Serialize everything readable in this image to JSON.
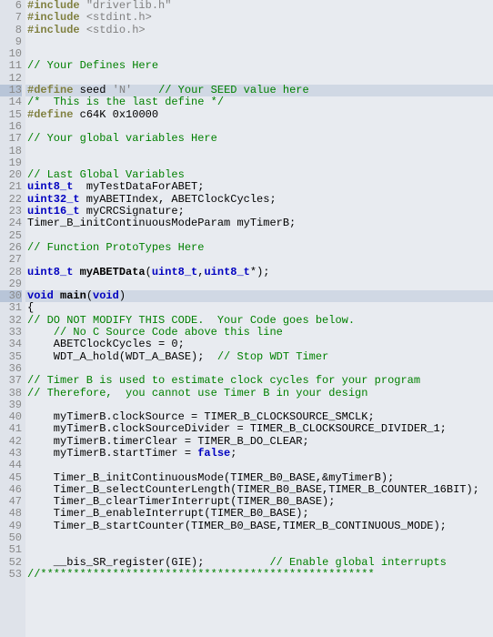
{
  "lines": [
    {
      "num": "6",
      "tokens": [
        [
          "k-pre",
          "#include"
        ],
        [
          "",
          " "
        ],
        [
          "k-str",
          "\"driverlib.h\""
        ]
      ]
    },
    {
      "num": "7",
      "tokens": [
        [
          "k-pre",
          "#include"
        ],
        [
          "",
          " "
        ],
        [
          "k-inc",
          "<stdint.h>"
        ]
      ]
    },
    {
      "num": "8",
      "tokens": [
        [
          "k-pre",
          "#include"
        ],
        [
          "",
          " "
        ],
        [
          "k-inc",
          "<stdio.h>"
        ]
      ]
    },
    {
      "num": "9",
      "tokens": [
        [
          "",
          ""
        ]
      ]
    },
    {
      "num": "10",
      "tokens": [
        [
          "",
          ""
        ]
      ]
    },
    {
      "num": "11",
      "tokens": [
        [
          "k-cmt",
          "// Your Defines Here"
        ]
      ]
    },
    {
      "num": "12",
      "tokens": [
        [
          "",
          ""
        ]
      ]
    },
    {
      "num": "13",
      "highlighted": true,
      "tokens": [
        [
          "k-pre",
          "#define"
        ],
        [
          "",
          " seed "
        ],
        [
          "k-str",
          "'N'"
        ],
        [
          "",
          "    "
        ],
        [
          "k-cmt",
          "// Your SEED value here"
        ]
      ]
    },
    {
      "num": "14",
      "tokens": [
        [
          "k-cmt",
          "/*  This is the last define */"
        ]
      ]
    },
    {
      "num": "15",
      "tokens": [
        [
          "k-pre",
          "#define"
        ],
        [
          "",
          " c64K "
        ],
        [
          "k-num",
          "0x10000"
        ]
      ]
    },
    {
      "num": "16",
      "tokens": [
        [
          "",
          ""
        ]
      ]
    },
    {
      "num": "17",
      "tokens": [
        [
          "k-cmt",
          "// Your global variables Here"
        ]
      ]
    },
    {
      "num": "18",
      "tokens": [
        [
          "",
          ""
        ]
      ]
    },
    {
      "num": "19",
      "tokens": [
        [
          "",
          ""
        ]
      ]
    },
    {
      "num": "20",
      "tokens": [
        [
          "k-cmt",
          "// Last Global Variables"
        ]
      ]
    },
    {
      "num": "21",
      "tokens": [
        [
          "k-type",
          "uint8_t"
        ],
        [
          "",
          "  myTestDataForABET;"
        ]
      ]
    },
    {
      "num": "22",
      "tokens": [
        [
          "k-type",
          "uint32_t"
        ],
        [
          "",
          " myABETIndex, ABETClockCycles;"
        ]
      ]
    },
    {
      "num": "23",
      "tokens": [
        [
          "k-type",
          "uint16_t"
        ],
        [
          "",
          " myCRCSignature;"
        ]
      ]
    },
    {
      "num": "24",
      "tokens": [
        [
          "",
          "Timer_B_initContinuousModeParam myTimerB;"
        ]
      ]
    },
    {
      "num": "25",
      "tokens": [
        [
          "",
          ""
        ]
      ]
    },
    {
      "num": "26",
      "tokens": [
        [
          "k-cmt",
          "// Function ProtoTypes Here"
        ]
      ]
    },
    {
      "num": "27",
      "tokens": [
        [
          "",
          ""
        ]
      ]
    },
    {
      "num": "28",
      "tokens": [
        [
          "k-type",
          "uint8_t"
        ],
        [
          "",
          " "
        ],
        [
          "k-func",
          "myABETData"
        ],
        [
          "",
          "("
        ],
        [
          "k-type",
          "uint8_t"
        ],
        [
          "",
          ","
        ],
        [
          "k-type",
          "uint8_t"
        ],
        [
          "",
          "*);"
        ]
      ]
    },
    {
      "num": "29",
      "tokens": [
        [
          "",
          ""
        ]
      ]
    },
    {
      "num": "30",
      "highlighted": true,
      "tokens": [
        [
          "k-kw",
          "void"
        ],
        [
          "",
          " "
        ],
        [
          "k-func",
          "main"
        ],
        [
          "",
          "("
        ],
        [
          "k-kw",
          "void"
        ],
        [
          "",
          ")"
        ]
      ]
    },
    {
      "num": "31",
      "tokens": [
        [
          "",
          "{"
        ]
      ]
    },
    {
      "num": "32",
      "tokens": [
        [
          "k-cmt",
          "// DO NOT MODIFY THIS CODE.  Your Code goes below."
        ]
      ]
    },
    {
      "num": "33",
      "tokens": [
        [
          "",
          "    "
        ],
        [
          "k-cmt",
          "// No C Source Code above this line"
        ]
      ]
    },
    {
      "num": "34",
      "tokens": [
        [
          "",
          "    ABETClockCycles = 0;"
        ]
      ]
    },
    {
      "num": "35",
      "tokens": [
        [
          "",
          "    WDT_A_hold(WDT_A_BASE);  "
        ],
        [
          "k-cmt",
          "// Stop WDT Timer"
        ]
      ]
    },
    {
      "num": "36",
      "tokens": [
        [
          "",
          ""
        ]
      ]
    },
    {
      "num": "37",
      "tokens": [
        [
          "k-cmt",
          "// Timer B is used to estimate clock cycles for your program"
        ]
      ]
    },
    {
      "num": "38",
      "tokens": [
        [
          "k-cmt",
          "// Therefore,  you cannot use Timer B in your design"
        ]
      ]
    },
    {
      "num": "39",
      "tokens": [
        [
          "",
          ""
        ]
      ]
    },
    {
      "num": "40",
      "tokens": [
        [
          "",
          "    myTimerB.clockSource = TIMER_B_CLOCKSOURCE_SMCLK;"
        ]
      ]
    },
    {
      "num": "41",
      "tokens": [
        [
          "",
          "    myTimerB.clockSourceDivider = TIMER_B_CLOCKSOURCE_DIVIDER_1;"
        ]
      ]
    },
    {
      "num": "42",
      "tokens": [
        [
          "",
          "    myTimerB.timerClear = TIMER_B_DO_CLEAR;"
        ]
      ]
    },
    {
      "num": "43",
      "tokens": [
        [
          "",
          "    myTimerB.startTimer = "
        ],
        [
          "k-kw",
          "false"
        ],
        [
          "",
          ";"
        ]
      ]
    },
    {
      "num": "44",
      "tokens": [
        [
          "",
          ""
        ]
      ]
    },
    {
      "num": "45",
      "tokens": [
        [
          "",
          "    Timer_B_initContinuousMode(TIMER_B0_BASE,&myTimerB);"
        ]
      ]
    },
    {
      "num": "46",
      "tokens": [
        [
          "",
          "    Timer_B_selectCounterLength(TIMER_B0_BASE,TIMER_B_COUNTER_16BIT);"
        ]
      ]
    },
    {
      "num": "47",
      "tokens": [
        [
          "",
          "    Timer_B_clearTimerInterrupt(TIMER_B0_BASE);"
        ]
      ]
    },
    {
      "num": "48",
      "tokens": [
        [
          "",
          "    Timer_B_enableInterrupt(TIMER_B0_BASE);"
        ]
      ]
    },
    {
      "num": "49",
      "tokens": [
        [
          "",
          "    Timer_B_startCounter(TIMER_B0_BASE,TIMER_B_CONTINUOUS_MODE);"
        ]
      ]
    },
    {
      "num": "50",
      "tokens": [
        [
          "",
          ""
        ]
      ]
    },
    {
      "num": "51",
      "tokens": [
        [
          "",
          ""
        ]
      ]
    },
    {
      "num": "52",
      "tokens": [
        [
          "",
          "    __bis_SR_register(GIE);          "
        ],
        [
          "k-cmt",
          "// Enable global interrupts"
        ]
      ]
    },
    {
      "num": "53",
      "tokens": [
        [
          "k-cmt",
          "//***************************************************"
        ]
      ]
    }
  ]
}
